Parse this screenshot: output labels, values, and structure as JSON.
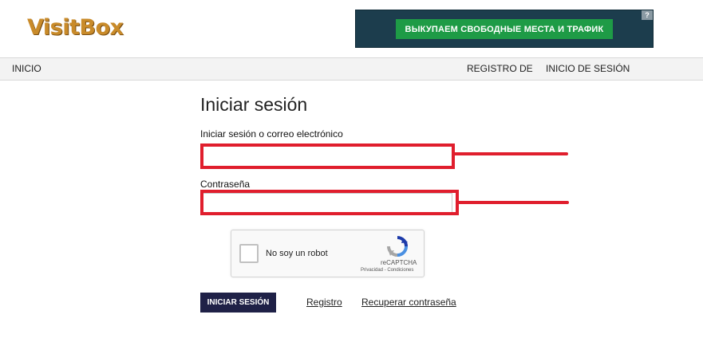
{
  "header": {
    "logo_text": "VisitBox",
    "banner": {
      "text": "ВЫКУПАЕМ СВОБОДНЫЕ МЕСТА И ТРАФИК",
      "help_glyph": "?"
    }
  },
  "nav": {
    "home": "INICIO",
    "register": "REGISTRO DE",
    "login": "INICIO DE SESIÓN"
  },
  "form": {
    "title": "Iniciar sesión",
    "login_label": "Iniciar sesión o correo electrónico",
    "login_value": "",
    "password_label": "Contraseña",
    "password_value": "",
    "highlight_color": "#e01e2d"
  },
  "recaptcha": {
    "label": "No soy un robot",
    "brand": "reCAPTCHA",
    "links": "Privacidad - Condiciones"
  },
  "actions": {
    "submit_label": "INICIAR SESIÓN",
    "register_link": "Registro",
    "recover_link": "Recuperar contraseña"
  },
  "colors": {
    "submit_bg": "#1f2147",
    "banner_bg": "#1c3d4d",
    "banner_button": "#1e9b46",
    "logo": "#c98b2a"
  }
}
